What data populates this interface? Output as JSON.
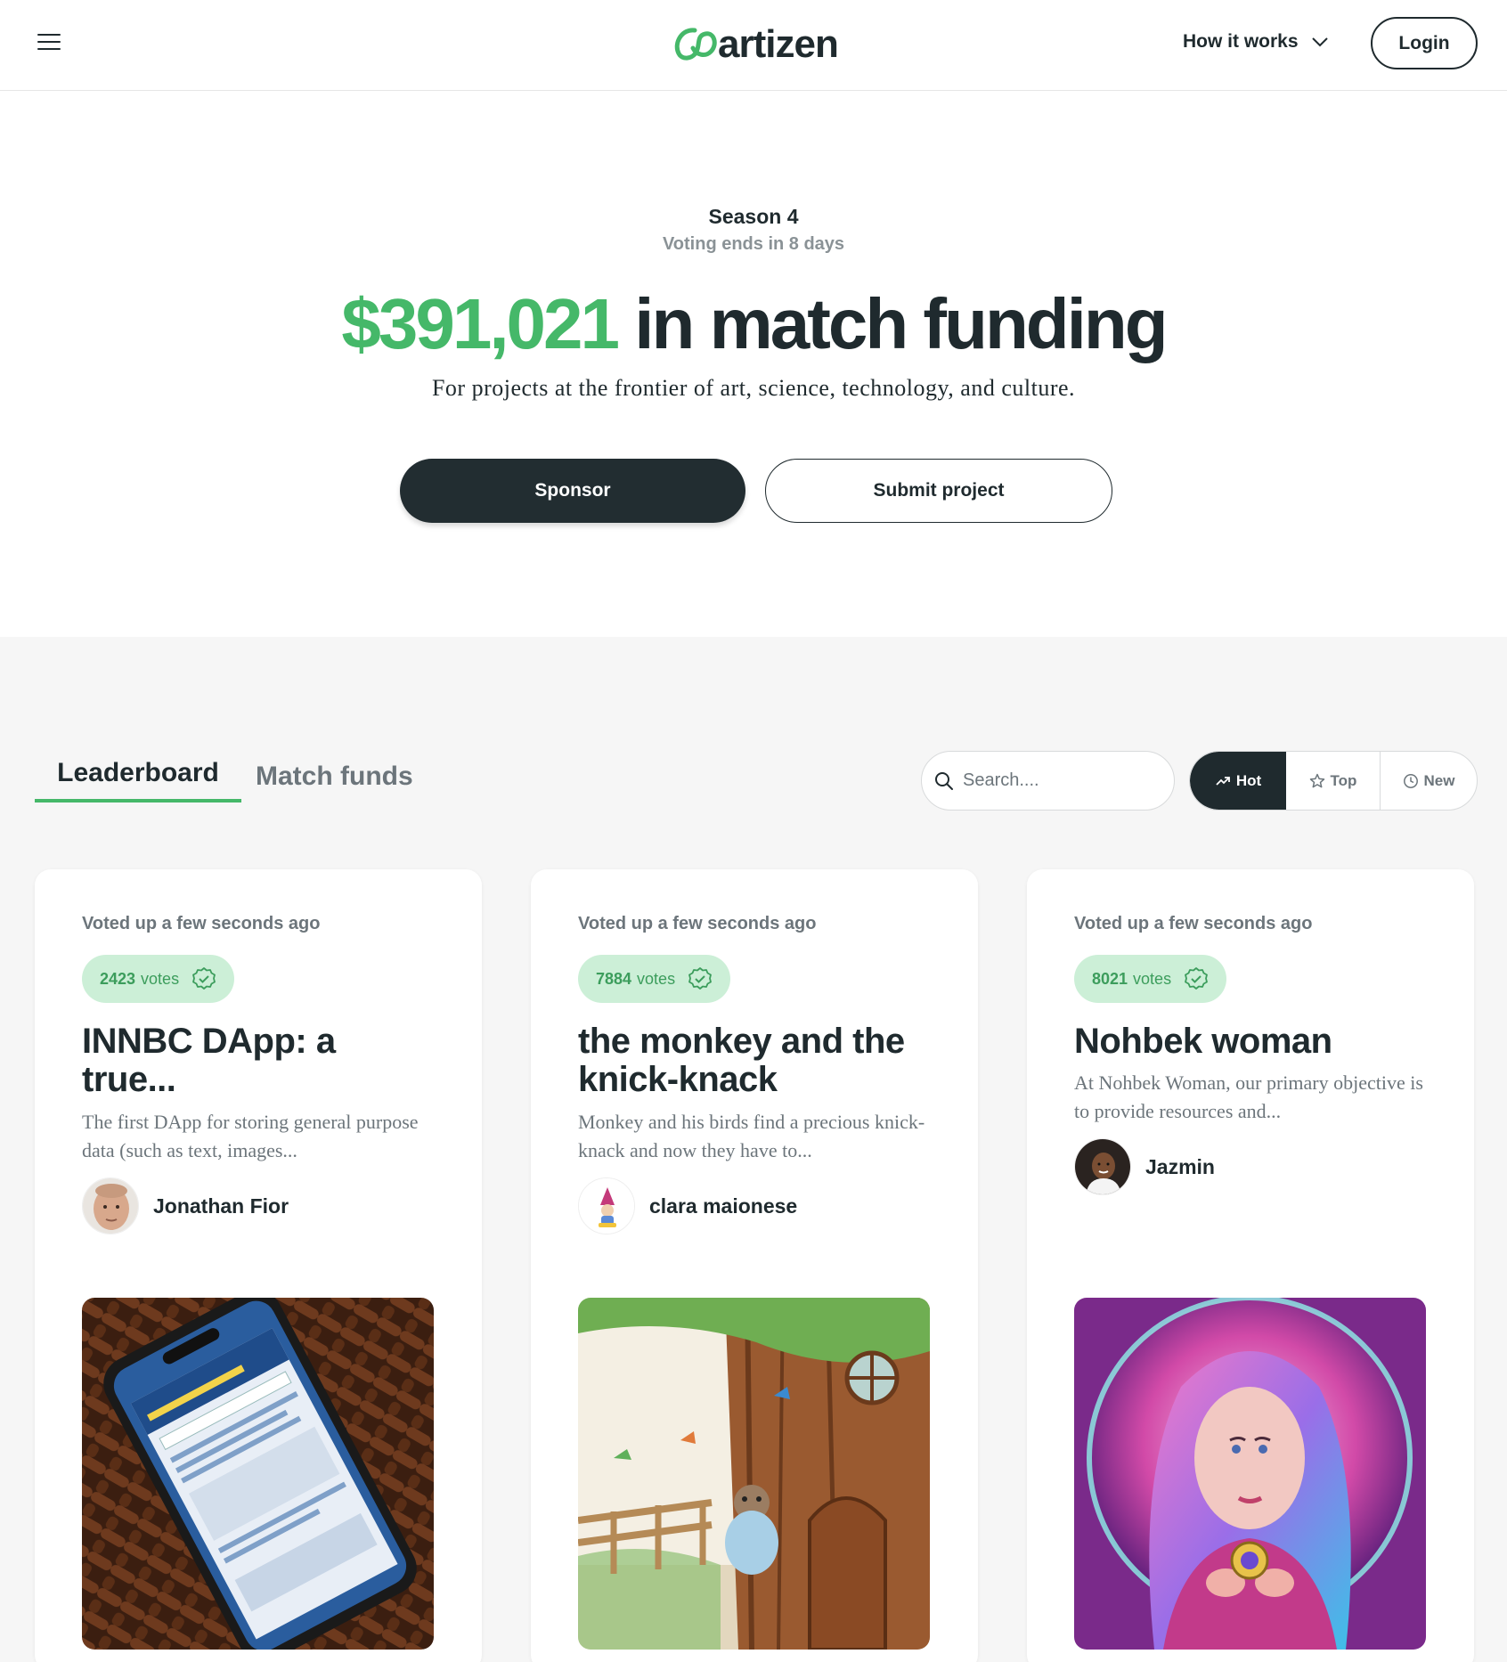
{
  "header": {
    "logo_text": "artizen",
    "nav_how_it_works": "How it works",
    "login_label": "Login",
    "icons": [
      "hamburger-menu-icon",
      "artizen-logo-mark",
      "chevron-down-icon"
    ]
  },
  "hero": {
    "season": "Season 4",
    "voting_status": "Voting ends in 8 days",
    "amount": "$391,021",
    "headline_suffix": " in match funding",
    "tagline": "For projects at the frontier of art, science, technology, and culture.",
    "sponsor_label": "Sponsor",
    "submit_label": "Submit project"
  },
  "leaderboard": {
    "tabs": [
      {
        "label": "Leaderboard",
        "active": true
      },
      {
        "label": "Match funds",
        "active": false
      }
    ],
    "search_placeholder": "Search....",
    "sort_options": [
      {
        "label": "Hot",
        "icon": "trending-up-icon",
        "active": true
      },
      {
        "label": "Top",
        "icon": "star-icon",
        "active": false
      },
      {
        "label": "New",
        "icon": "clock-icon",
        "active": false
      }
    ],
    "cards": [
      {
        "voted": "Voted up a few seconds ago",
        "votes_count": "2423",
        "votes_label": "votes",
        "title": "INNBC DApp: a true...",
        "description": "The first DApp for storing general purpose data (such as text, images...",
        "author": "Jonathan Fior"
      },
      {
        "voted": "Voted up a few seconds ago",
        "votes_count": "7884",
        "votes_label": "votes",
        "title": "the monkey and the knick-knack",
        "description": "Monkey and his birds find a precious knick-knack and now they have to...",
        "author": "clara maionese"
      },
      {
        "voted": "Voted up a few seconds ago",
        "votes_count": "8021",
        "votes_label": "votes",
        "title": "Nohbek woman",
        "description": "At Nohbek Woman, our primary objective is to provide resources and...",
        "author": "Jazmin"
      }
    ]
  },
  "colors": {
    "accent_green": "#45b869",
    "badge_green_bg": "#ccefd7",
    "dark": "#1f2a2e",
    "muted": "#6c757b"
  }
}
